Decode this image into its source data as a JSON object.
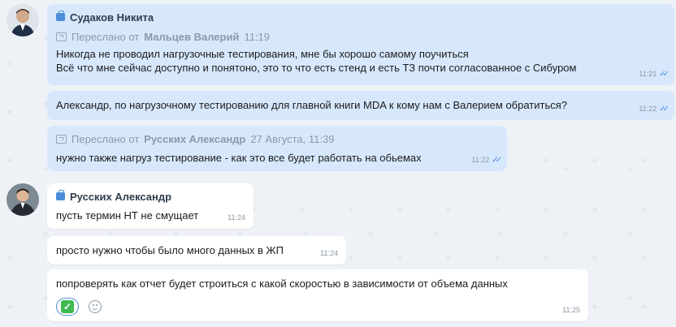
{
  "messages": [
    {
      "sender": "Судаков Никита",
      "forward_label": "Переслано от",
      "forward_from": "Мальцев Валерий",
      "forward_time": "11:19",
      "lines": [
        "Никогда не проводил нагрузочные тестирования, мне бы хорошо самому поучиться",
        "Всё что мне сейчас доступно и понятоно, это то что есть стенд и есть ТЗ почти согласованное с Сибуром"
      ],
      "time": "11:21",
      "read": true
    },
    {
      "text": "Александр, по нагрузочному тестированию для главной книги MDA к кому нам с Валерием обратиться?",
      "time": "11:22",
      "read": true
    },
    {
      "forward_label": "Переслано от",
      "forward_from": "Русских Александр",
      "forward_time": "27 Августа, 11:39",
      "text": "нужно также нагруз тестирование - как это все будет работать на обьемах",
      "time": "11:22",
      "read": true
    },
    {
      "sender": "Русских Александр",
      "text": "пусть термин НТ не смущает",
      "time": "11:24"
    },
    {
      "text": "просто нужно чтобы было много данных в ЖП",
      "time": "11:24"
    },
    {
      "text": "попроверять как отчет будет строиться с какой скоростью в зависимости от объема данных",
      "time": "11:25",
      "reaction": "✅"
    }
  ],
  "icons": {
    "sender": "briefcase-icon",
    "forward": "forward-icon",
    "read": "double-check-icon",
    "add_reaction": "smile-icon"
  },
  "colors": {
    "own_bubble": "#d7e8fd",
    "other_bubble": "#ffffff",
    "accent": "#4d8dd8",
    "background": "#eef2f6"
  }
}
